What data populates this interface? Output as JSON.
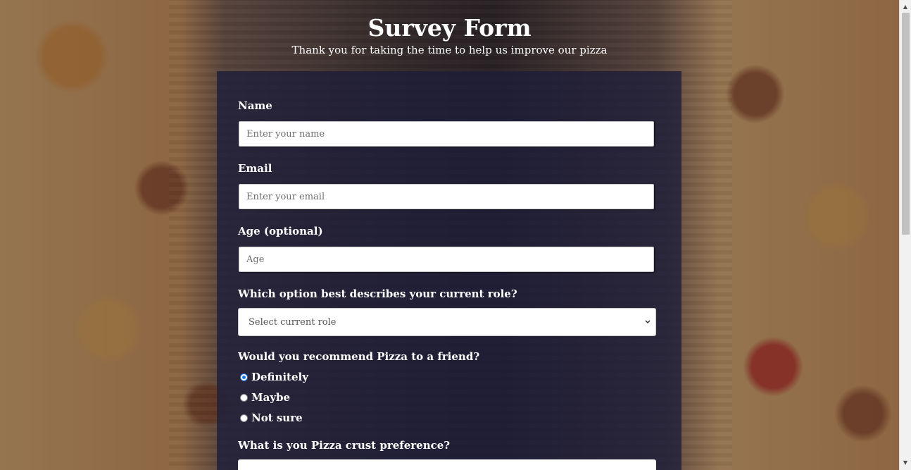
{
  "header": {
    "title": "Survey Form",
    "subtitle": "Thank you for taking the time to help us improve our pizza"
  },
  "form": {
    "name": {
      "label": "Name",
      "placeholder": "Enter your name",
      "value": ""
    },
    "email": {
      "label": "Email",
      "placeholder": "Enter your email",
      "value": ""
    },
    "age": {
      "label": "Age (optional)",
      "placeholder": "Age",
      "value": ""
    },
    "role": {
      "label": "Which option best describes your current role?",
      "selected": "Select current role"
    },
    "recommend": {
      "label": "Would you recommend Pizza to a friend?",
      "options": [
        {
          "label": "Definitely",
          "checked": true
        },
        {
          "label": "Maybe",
          "checked": false
        },
        {
          "label": "Not sure",
          "checked": false
        }
      ]
    },
    "crust": {
      "label": "What is you Pizza crust preference?"
    }
  },
  "icons": {
    "select_chevron": "chevron-down-icon",
    "scroll_up": "scroll-up-arrow-icon",
    "scroll_down": "scroll-down-arrow-icon"
  },
  "colors": {
    "form_background": "#1e1e3a",
    "text": "#ffffff",
    "radio_accent": "#1a73e8"
  },
  "scrollbar": {
    "visible_fraction": 0.49
  }
}
